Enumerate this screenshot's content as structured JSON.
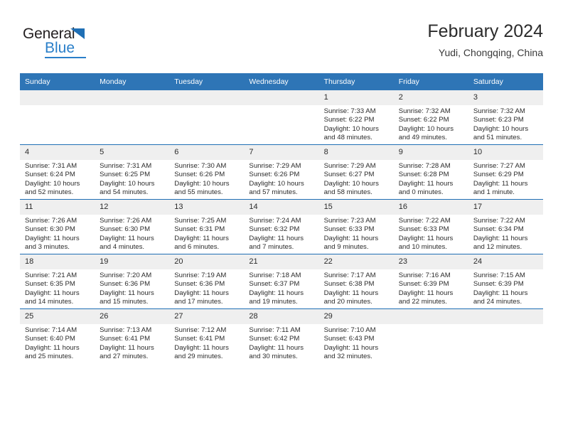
{
  "brand": {
    "name_part1": "General",
    "name_part2": "Blue",
    "accent_color": "#2a7fc9",
    "triangle_icon": "triangle-icon"
  },
  "header": {
    "title": "February 2024",
    "subtitle": "Yudi, Chongqing, China"
  },
  "calendar": {
    "header_bg": "#2e75b6",
    "row_divider": "#1f6fb5",
    "daynum_bg": "#efefef",
    "weekday_headers": [
      "Sunday",
      "Monday",
      "Tuesday",
      "Wednesday",
      "Thursday",
      "Friday",
      "Saturday"
    ],
    "weeks": [
      [
        {
          "day": "",
          "empty": true
        },
        {
          "day": "",
          "empty": true
        },
        {
          "day": "",
          "empty": true
        },
        {
          "day": "",
          "empty": true
        },
        {
          "day": "1",
          "sunrise": "Sunrise: 7:33 AM",
          "sunset": "Sunset: 6:22 PM",
          "daylight_line1": "Daylight: 10 hours",
          "daylight_line2": "and 48 minutes."
        },
        {
          "day": "2",
          "sunrise": "Sunrise: 7:32 AM",
          "sunset": "Sunset: 6:22 PM",
          "daylight_line1": "Daylight: 10 hours",
          "daylight_line2": "and 49 minutes."
        },
        {
          "day": "3",
          "sunrise": "Sunrise: 7:32 AM",
          "sunset": "Sunset: 6:23 PM",
          "daylight_line1": "Daylight: 10 hours",
          "daylight_line2": "and 51 minutes."
        }
      ],
      [
        {
          "day": "4",
          "sunrise": "Sunrise: 7:31 AM",
          "sunset": "Sunset: 6:24 PM",
          "daylight_line1": "Daylight: 10 hours",
          "daylight_line2": "and 52 minutes."
        },
        {
          "day": "5",
          "sunrise": "Sunrise: 7:31 AM",
          "sunset": "Sunset: 6:25 PM",
          "daylight_line1": "Daylight: 10 hours",
          "daylight_line2": "and 54 minutes."
        },
        {
          "day": "6",
          "sunrise": "Sunrise: 7:30 AM",
          "sunset": "Sunset: 6:26 PM",
          "daylight_line1": "Daylight: 10 hours",
          "daylight_line2": "and 55 minutes."
        },
        {
          "day": "7",
          "sunrise": "Sunrise: 7:29 AM",
          "sunset": "Sunset: 6:26 PM",
          "daylight_line1": "Daylight: 10 hours",
          "daylight_line2": "and 57 minutes."
        },
        {
          "day": "8",
          "sunrise": "Sunrise: 7:29 AM",
          "sunset": "Sunset: 6:27 PM",
          "daylight_line1": "Daylight: 10 hours",
          "daylight_line2": "and 58 minutes."
        },
        {
          "day": "9",
          "sunrise": "Sunrise: 7:28 AM",
          "sunset": "Sunset: 6:28 PM",
          "daylight_line1": "Daylight: 11 hours",
          "daylight_line2": "and 0 minutes."
        },
        {
          "day": "10",
          "sunrise": "Sunrise: 7:27 AM",
          "sunset": "Sunset: 6:29 PM",
          "daylight_line1": "Daylight: 11 hours",
          "daylight_line2": "and 1 minute."
        }
      ],
      [
        {
          "day": "11",
          "sunrise": "Sunrise: 7:26 AM",
          "sunset": "Sunset: 6:30 PM",
          "daylight_line1": "Daylight: 11 hours",
          "daylight_line2": "and 3 minutes."
        },
        {
          "day": "12",
          "sunrise": "Sunrise: 7:26 AM",
          "sunset": "Sunset: 6:30 PM",
          "daylight_line1": "Daylight: 11 hours",
          "daylight_line2": "and 4 minutes."
        },
        {
          "day": "13",
          "sunrise": "Sunrise: 7:25 AM",
          "sunset": "Sunset: 6:31 PM",
          "daylight_line1": "Daylight: 11 hours",
          "daylight_line2": "and 6 minutes."
        },
        {
          "day": "14",
          "sunrise": "Sunrise: 7:24 AM",
          "sunset": "Sunset: 6:32 PM",
          "daylight_line1": "Daylight: 11 hours",
          "daylight_line2": "and 7 minutes."
        },
        {
          "day": "15",
          "sunrise": "Sunrise: 7:23 AM",
          "sunset": "Sunset: 6:33 PM",
          "daylight_line1": "Daylight: 11 hours",
          "daylight_line2": "and 9 minutes."
        },
        {
          "day": "16",
          "sunrise": "Sunrise: 7:22 AM",
          "sunset": "Sunset: 6:33 PM",
          "daylight_line1": "Daylight: 11 hours",
          "daylight_line2": "and 10 minutes."
        },
        {
          "day": "17",
          "sunrise": "Sunrise: 7:22 AM",
          "sunset": "Sunset: 6:34 PM",
          "daylight_line1": "Daylight: 11 hours",
          "daylight_line2": "and 12 minutes."
        }
      ],
      [
        {
          "day": "18",
          "sunrise": "Sunrise: 7:21 AM",
          "sunset": "Sunset: 6:35 PM",
          "daylight_line1": "Daylight: 11 hours",
          "daylight_line2": "and 14 minutes."
        },
        {
          "day": "19",
          "sunrise": "Sunrise: 7:20 AM",
          "sunset": "Sunset: 6:36 PM",
          "daylight_line1": "Daylight: 11 hours",
          "daylight_line2": "and 15 minutes."
        },
        {
          "day": "20",
          "sunrise": "Sunrise: 7:19 AM",
          "sunset": "Sunset: 6:36 PM",
          "daylight_line1": "Daylight: 11 hours",
          "daylight_line2": "and 17 minutes."
        },
        {
          "day": "21",
          "sunrise": "Sunrise: 7:18 AM",
          "sunset": "Sunset: 6:37 PM",
          "daylight_line1": "Daylight: 11 hours",
          "daylight_line2": "and 19 minutes."
        },
        {
          "day": "22",
          "sunrise": "Sunrise: 7:17 AM",
          "sunset": "Sunset: 6:38 PM",
          "daylight_line1": "Daylight: 11 hours",
          "daylight_line2": "and 20 minutes."
        },
        {
          "day": "23",
          "sunrise": "Sunrise: 7:16 AM",
          "sunset": "Sunset: 6:39 PM",
          "daylight_line1": "Daylight: 11 hours",
          "daylight_line2": "and 22 minutes."
        },
        {
          "day": "24",
          "sunrise": "Sunrise: 7:15 AM",
          "sunset": "Sunset: 6:39 PM",
          "daylight_line1": "Daylight: 11 hours",
          "daylight_line2": "and 24 minutes."
        }
      ],
      [
        {
          "day": "25",
          "sunrise": "Sunrise: 7:14 AM",
          "sunset": "Sunset: 6:40 PM",
          "daylight_line1": "Daylight: 11 hours",
          "daylight_line2": "and 25 minutes."
        },
        {
          "day": "26",
          "sunrise": "Sunrise: 7:13 AM",
          "sunset": "Sunset: 6:41 PM",
          "daylight_line1": "Daylight: 11 hours",
          "daylight_line2": "and 27 minutes."
        },
        {
          "day": "27",
          "sunrise": "Sunrise: 7:12 AM",
          "sunset": "Sunset: 6:41 PM",
          "daylight_line1": "Daylight: 11 hours",
          "daylight_line2": "and 29 minutes."
        },
        {
          "day": "28",
          "sunrise": "Sunrise: 7:11 AM",
          "sunset": "Sunset: 6:42 PM",
          "daylight_line1": "Daylight: 11 hours",
          "daylight_line2": "and 30 minutes."
        },
        {
          "day": "29",
          "sunrise": "Sunrise: 7:10 AM",
          "sunset": "Sunset: 6:43 PM",
          "daylight_line1": "Daylight: 11 hours",
          "daylight_line2": "and 32 minutes."
        },
        {
          "day": "",
          "empty": true
        },
        {
          "day": "",
          "empty": true
        }
      ]
    ]
  }
}
